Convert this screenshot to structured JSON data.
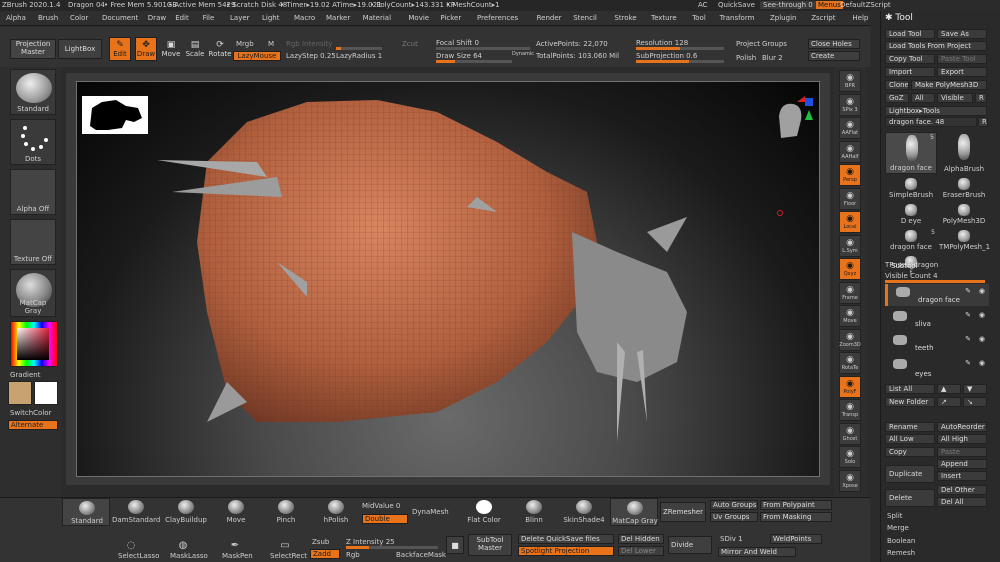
{
  "statusbar": {
    "app": "ZBrush 2020.1.4",
    "doc": "Dragon 04",
    "freemem": "• Free Mem 5.901GB",
    "activemem": "• Active Mem 5429",
    "scratch": "• Scratch Disk 48",
    "timer": "• Timer▸19.02 ATime▸19.021",
    "polycount": "• PolyCount▸143.331 KP",
    "meshcount": "• MeshCount▸1",
    "ac": "AC",
    "quicksave": "QuickSave",
    "seethrough": "See-through 0",
    "menus": "Menus",
    "defaultzscript": "DefaultZScript"
  },
  "menus": [
    "Alpha",
    "Brush",
    "Color",
    "Document",
    "Draw",
    "Edit",
    "File",
    "Layer",
    "Light",
    "Macro",
    "Marker",
    "Material",
    "Movie",
    "Picker",
    "Preferences",
    "Render",
    "Stencil",
    "Stroke",
    "Texture",
    "Tool",
    "Transform",
    "Zplugin",
    "Zscript",
    "Help"
  ],
  "toolbar": {
    "projection_master": "Projection Master",
    "lightbox": "LightBox",
    "edit": "Edit",
    "draw": "Draw",
    "move": "Move",
    "scale": "Scale",
    "rotate": "Rotate",
    "mrgb": "Mrgb",
    "m": "M",
    "rgb_intensity": "Rgb Intensity",
    "lazymouse": "LazyMouse",
    "lazystep": "LazyStep 0.25",
    "lazyradius": "LazyRadius 1",
    "zcut": "Zcut",
    "focal_shift": "Focal Shift 0",
    "draw_size": "Draw Size 64",
    "dynamic": "Dynamic",
    "active_points": "ActivePoints: 22,070",
    "total_points": "TotalPoints: 103.060 Mil",
    "resolution": "Resolution 128",
    "subprojection": "SubProjection 0.6",
    "project": "Project",
    "groups": "Groups",
    "polish": "Polish",
    "blur": "Blur 2",
    "close_holes": "Close Holes",
    "create": "Create",
    "focal_shift_pct": 0.0,
    "draw_size_pct": 0.25,
    "resolution_pct": 0.5,
    "subprojection_pct": 0.6
  },
  "leftshelf": {
    "standard": "Standard",
    "dots": "Dots",
    "alpha_off": "Alpha Off",
    "texture_off": "Texture Off",
    "matcap": "MatCap Gray",
    "gradient": "Gradient",
    "switchcolor": "SwitchColor",
    "alternate": "Alternate"
  },
  "rightshelf": [
    {
      "name": "bpr",
      "label": "BPR",
      "orange": false
    },
    {
      "name": "spix",
      "label": "SPix 3",
      "orange": false
    },
    {
      "name": "aaflat",
      "label": "AAFlat",
      "orange": false
    },
    {
      "name": "aahalf",
      "label": "AAHalf",
      "orange": false
    },
    {
      "name": "persp",
      "label": "Persp",
      "orange": true
    },
    {
      "name": "floor",
      "label": "Floor",
      "orange": false
    },
    {
      "name": "local",
      "label": "Local",
      "orange": true
    },
    {
      "name": "lsym",
      "label": "L.Sym",
      "orange": false
    },
    {
      "name": "xyz",
      "label": "Qxyz",
      "orange": true
    },
    {
      "name": "frame",
      "label": "Frame",
      "orange": false
    },
    {
      "name": "move",
      "label": "Move",
      "orange": false
    },
    {
      "name": "zoom3d",
      "label": "Zoom3D",
      "orange": false
    },
    {
      "name": "rotate",
      "label": "RotaTe",
      "orange": false
    },
    {
      "name": "polyf",
      "label": "PolyF",
      "orange": true
    },
    {
      "name": "transp",
      "label": "Transp",
      "orange": false
    },
    {
      "name": "ghost",
      "label": "Ghost",
      "orange": false
    },
    {
      "name": "solo",
      "label": "Solo",
      "orange": false
    },
    {
      "name": "xpose",
      "label": "Xpose",
      "orange": false
    }
  ],
  "bottombar": {
    "brushes": [
      "Standard",
      "DamStandard",
      "ClayBuildup",
      "Move",
      "Pinch",
      "hPolish"
    ],
    "midvalue": "MidValue 0",
    "double": "Double",
    "dynamesh": "DynaMesh",
    "materials": [
      "Flat Color",
      "Blinn",
      "SkinShade4",
      "MatCap Gray"
    ],
    "zremesher": "ZRemesher",
    "auto_groups": "Auto Groups",
    "from_polypaint": "From Polypaint",
    "uv_groups": "Uv Groups",
    "from_masking": "From Masking",
    "selectlasso": "SelectLasso",
    "masklasso": "MaskLasso",
    "maskpen": "MaskPen",
    "selectrect": "SelectRect",
    "zsub": "Zsub",
    "zadd": "Zadd",
    "rgb": "Rgb",
    "z_intensity": "Z Intensity 25",
    "backfacemask": "BackfaceMask",
    "subtool_master": "SubTool Master",
    "delete_quicksave": "Delete QuickSave files",
    "spotlight": "Spotlight Projection",
    "del_hidden": "Del Hidden",
    "del_lower": "Del Lower",
    "divide": "Divide",
    "sdiv": "SDiv 1",
    "weldpoints": "WeldPoints",
    "mirror_weld": "Mirror And Weld",
    "z_intensity_pct": 0.25
  },
  "rightpanel": {
    "title": "Tool",
    "load_tool": "Load Tool",
    "save_as": "Save As",
    "load_tools_from_project": "Load Tools From Project",
    "copy_tool": "Copy Tool",
    "paste_tool": "Paste Tool",
    "import": "Import",
    "export": "Export",
    "clone": "Clone",
    "make_polymesh": "Make PolyMesh3D",
    "goz": "GoZ",
    "all": "All",
    "visible": "Visible",
    "r": "R",
    "lightbox_tools": "Lightbox▸Tools",
    "dragon_face": "dragon face. 48",
    "tools": [
      {
        "name": "dragon face",
        "count": "5"
      },
      {
        "name": "AlphaBrush",
        "count": ""
      },
      {
        "name": "SimpleBrush",
        "count": ""
      },
      {
        "name": "EraserBrush",
        "count": ""
      },
      {
        "name": "D eye",
        "count": ""
      },
      {
        "name": "PolyMesh3D",
        "count": ""
      },
      {
        "name": "dragon face",
        "count": "5"
      },
      {
        "name": "TMPolyMesh_1",
        "count": ""
      },
      {
        "name": "TPose1_dragon f",
        "count": ""
      }
    ],
    "subtool": "Subtool",
    "visible_count": "Visible Count 4",
    "subtools": [
      "dragon face",
      "sliva",
      "teeth",
      "eyes"
    ],
    "list_all": "List All",
    "new_folder": "New Folder",
    "rename": "Rename",
    "autoreorder": "AutoReorder",
    "all_low": "All Low",
    "all_high": "All High",
    "copy": "Copy",
    "paste": "Paste",
    "append": "Append",
    "duplicate": "Duplicate",
    "insert": "Insert",
    "delete": "Delete",
    "del_other": "Del Other",
    "del_all": "Del All",
    "split": "Split",
    "merge": "Merge",
    "boolean": "Boolean",
    "remesh": "Remesh"
  },
  "colors": {
    "accent": "#e8731b",
    "dragon_skin": "#c06a45",
    "teeth": "#9a9a9a"
  }
}
